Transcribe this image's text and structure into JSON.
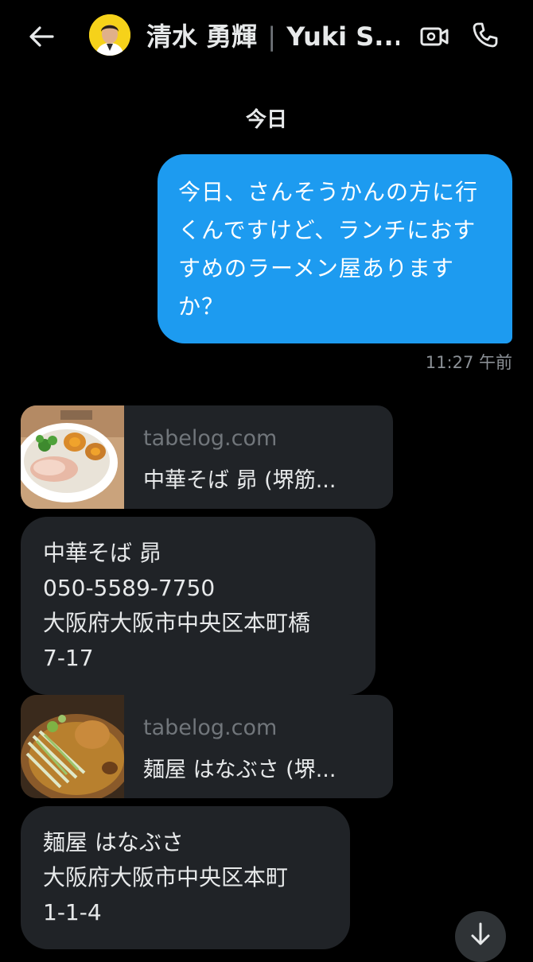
{
  "header": {
    "name": "清水 勇輝",
    "separator": "|",
    "handle": "Yuki S..."
  },
  "date_divider": "今日",
  "sent_message": {
    "text": "今日、さんそうかんの方に行くんですけど、ランチにおすすめのラーメン屋ありますか？",
    "time": "11:27 午前"
  },
  "link_cards": [
    {
      "domain": "tabelog.com",
      "title": "中華そば 昴 (堺筋..."
    },
    {
      "domain": "tabelog.com",
      "title": "麺屋 はなぶさ (堺..."
    }
  ],
  "received_messages": [
    {
      "lines": [
        "中華そば 昴",
        "050-5589-7750",
        "大阪府大阪市中央区本町橋",
        "7-17"
      ]
    },
    {
      "lines": [
        "麺屋 はなぶさ",
        "大阪府大阪市中央区本町",
        "1-1-4"
      ]
    }
  ],
  "colors": {
    "background": "#000000",
    "sent_bubble": "#1d9bf0",
    "received_bubble": "#202327",
    "muted_text": "#71767b",
    "avatar_bg": "#f6d21a"
  },
  "icons": {
    "back": "arrow-left-icon",
    "video": "video-camera-icon",
    "call": "phone-icon",
    "scroll": "arrow-down-icon"
  }
}
